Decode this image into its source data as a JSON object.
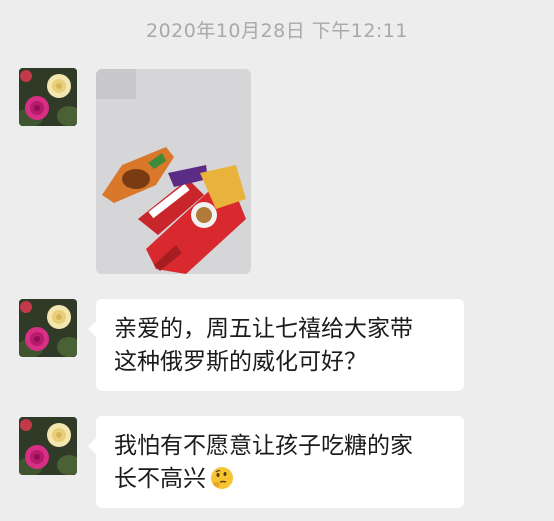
{
  "chat": {
    "timestamp": "2020年10月28日 下午12:11",
    "messages": [
      {
        "type": "image",
        "avatar_icon": "rose-flowers-avatar",
        "image_desc_icon": "candy-photo"
      },
      {
        "type": "text",
        "avatar_icon": "rose-flowers-avatar",
        "lines": [
          "亲爱的，周五让七禧给大家带",
          "这种俄罗斯的威化可好？"
        ]
      },
      {
        "type": "text",
        "avatar_icon": "rose-flowers-avatar",
        "lines": [
          "我怕有不愿意让孩子吃糖的家",
          "长不高兴"
        ],
        "emoji": "thinking-face-icon"
      }
    ]
  },
  "colors": {
    "background": "#ededed",
    "bubble": "#ffffff",
    "timestamp_text": "#a9a9a9",
    "message_text": "#1b1b1b"
  }
}
